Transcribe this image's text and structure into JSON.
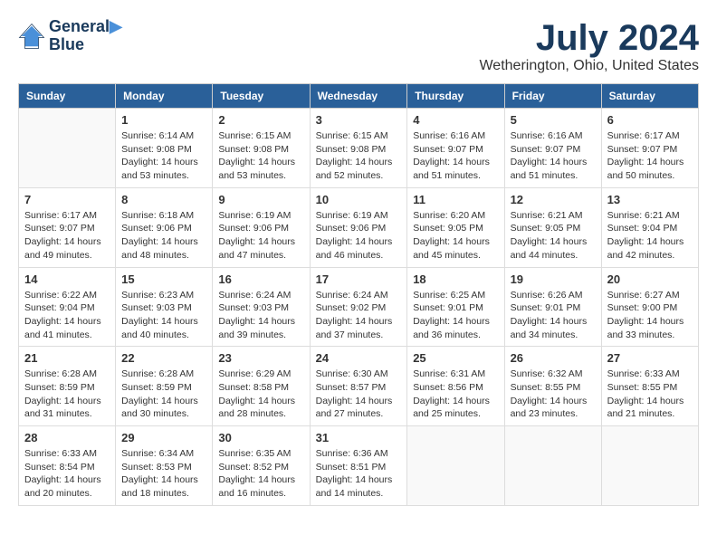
{
  "logo": {
    "line1": "General",
    "line2": "Blue"
  },
  "title": {
    "month": "July 2024",
    "location": "Wetherington, Ohio, United States"
  },
  "headers": [
    "Sunday",
    "Monday",
    "Tuesday",
    "Wednesday",
    "Thursday",
    "Friday",
    "Saturday"
  ],
  "weeks": [
    [
      {
        "day": "",
        "info": ""
      },
      {
        "day": "1",
        "info": "Sunrise: 6:14 AM\nSunset: 9:08 PM\nDaylight: 14 hours\nand 53 minutes."
      },
      {
        "day": "2",
        "info": "Sunrise: 6:15 AM\nSunset: 9:08 PM\nDaylight: 14 hours\nand 53 minutes."
      },
      {
        "day": "3",
        "info": "Sunrise: 6:15 AM\nSunset: 9:08 PM\nDaylight: 14 hours\nand 52 minutes."
      },
      {
        "day": "4",
        "info": "Sunrise: 6:16 AM\nSunset: 9:07 PM\nDaylight: 14 hours\nand 51 minutes."
      },
      {
        "day": "5",
        "info": "Sunrise: 6:16 AM\nSunset: 9:07 PM\nDaylight: 14 hours\nand 51 minutes."
      },
      {
        "day": "6",
        "info": "Sunrise: 6:17 AM\nSunset: 9:07 PM\nDaylight: 14 hours\nand 50 minutes."
      }
    ],
    [
      {
        "day": "7",
        "info": "Sunrise: 6:17 AM\nSunset: 9:07 PM\nDaylight: 14 hours\nand 49 minutes."
      },
      {
        "day": "8",
        "info": "Sunrise: 6:18 AM\nSunset: 9:06 PM\nDaylight: 14 hours\nand 48 minutes."
      },
      {
        "day": "9",
        "info": "Sunrise: 6:19 AM\nSunset: 9:06 PM\nDaylight: 14 hours\nand 47 minutes."
      },
      {
        "day": "10",
        "info": "Sunrise: 6:19 AM\nSunset: 9:06 PM\nDaylight: 14 hours\nand 46 minutes."
      },
      {
        "day": "11",
        "info": "Sunrise: 6:20 AM\nSunset: 9:05 PM\nDaylight: 14 hours\nand 45 minutes."
      },
      {
        "day": "12",
        "info": "Sunrise: 6:21 AM\nSunset: 9:05 PM\nDaylight: 14 hours\nand 44 minutes."
      },
      {
        "day": "13",
        "info": "Sunrise: 6:21 AM\nSunset: 9:04 PM\nDaylight: 14 hours\nand 42 minutes."
      }
    ],
    [
      {
        "day": "14",
        "info": "Sunrise: 6:22 AM\nSunset: 9:04 PM\nDaylight: 14 hours\nand 41 minutes."
      },
      {
        "day": "15",
        "info": "Sunrise: 6:23 AM\nSunset: 9:03 PM\nDaylight: 14 hours\nand 40 minutes."
      },
      {
        "day": "16",
        "info": "Sunrise: 6:24 AM\nSunset: 9:03 PM\nDaylight: 14 hours\nand 39 minutes."
      },
      {
        "day": "17",
        "info": "Sunrise: 6:24 AM\nSunset: 9:02 PM\nDaylight: 14 hours\nand 37 minutes."
      },
      {
        "day": "18",
        "info": "Sunrise: 6:25 AM\nSunset: 9:01 PM\nDaylight: 14 hours\nand 36 minutes."
      },
      {
        "day": "19",
        "info": "Sunrise: 6:26 AM\nSunset: 9:01 PM\nDaylight: 14 hours\nand 34 minutes."
      },
      {
        "day": "20",
        "info": "Sunrise: 6:27 AM\nSunset: 9:00 PM\nDaylight: 14 hours\nand 33 minutes."
      }
    ],
    [
      {
        "day": "21",
        "info": "Sunrise: 6:28 AM\nSunset: 8:59 PM\nDaylight: 14 hours\nand 31 minutes."
      },
      {
        "day": "22",
        "info": "Sunrise: 6:28 AM\nSunset: 8:59 PM\nDaylight: 14 hours\nand 30 minutes."
      },
      {
        "day": "23",
        "info": "Sunrise: 6:29 AM\nSunset: 8:58 PM\nDaylight: 14 hours\nand 28 minutes."
      },
      {
        "day": "24",
        "info": "Sunrise: 6:30 AM\nSunset: 8:57 PM\nDaylight: 14 hours\nand 27 minutes."
      },
      {
        "day": "25",
        "info": "Sunrise: 6:31 AM\nSunset: 8:56 PM\nDaylight: 14 hours\nand 25 minutes."
      },
      {
        "day": "26",
        "info": "Sunrise: 6:32 AM\nSunset: 8:55 PM\nDaylight: 14 hours\nand 23 minutes."
      },
      {
        "day": "27",
        "info": "Sunrise: 6:33 AM\nSunset: 8:55 PM\nDaylight: 14 hours\nand 21 minutes."
      }
    ],
    [
      {
        "day": "28",
        "info": "Sunrise: 6:33 AM\nSunset: 8:54 PM\nDaylight: 14 hours\nand 20 minutes."
      },
      {
        "day": "29",
        "info": "Sunrise: 6:34 AM\nSunset: 8:53 PM\nDaylight: 14 hours\nand 18 minutes."
      },
      {
        "day": "30",
        "info": "Sunrise: 6:35 AM\nSunset: 8:52 PM\nDaylight: 14 hours\nand 16 minutes."
      },
      {
        "day": "31",
        "info": "Sunrise: 6:36 AM\nSunset: 8:51 PM\nDaylight: 14 hours\nand 14 minutes."
      },
      {
        "day": "",
        "info": ""
      },
      {
        "day": "",
        "info": ""
      },
      {
        "day": "",
        "info": ""
      }
    ]
  ]
}
